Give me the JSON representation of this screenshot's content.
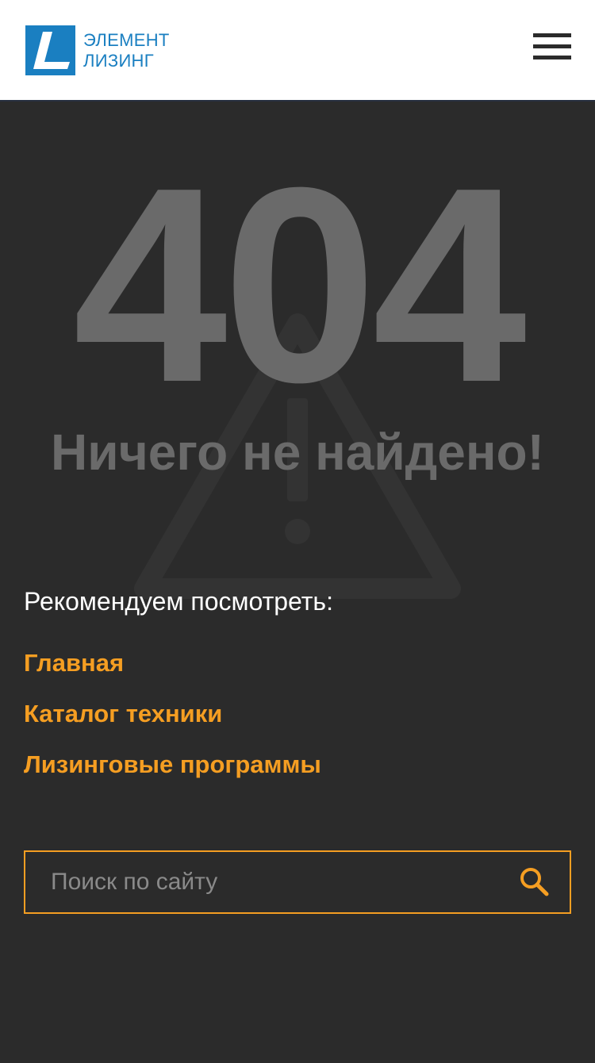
{
  "header": {
    "logo": {
      "line1": "ЭЛЕМЕНТ",
      "line2": "ЛИЗИНГ",
      "brand_color": "#1a7fc1"
    },
    "menu_icon": "hamburger-icon"
  },
  "error": {
    "code": "404",
    "message": "Ничего не найдено!",
    "background_icon": "warning-triangle-icon"
  },
  "recommend": {
    "title": "Рекомендуем посмотреть:",
    "links": [
      {
        "label": "Главная"
      },
      {
        "label": "Каталог техники"
      },
      {
        "label": "Лизинговые программы"
      }
    ]
  },
  "search": {
    "placeholder": "Поиск по сайту",
    "value": "",
    "icon": "search-icon"
  },
  "colors": {
    "background": "#2b2b2b",
    "accent": "#f59e22",
    "muted_text": "#6a6a6a",
    "header_bg": "#ffffff"
  }
}
